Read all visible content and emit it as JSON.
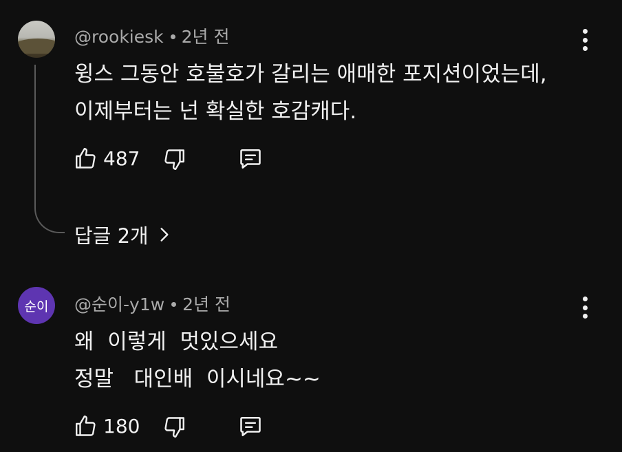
{
  "comments": [
    {
      "handle": "@rookiesk",
      "age": "2년 전",
      "text_lines": [
        "윙스 그동안 호불호가 갈리는 애매한 포지션이었는데,",
        "이제부터는 넌 확실한 호감캐다."
      ],
      "likes": "487",
      "avatar_icon": "landscape-photo-avatar"
    },
    {
      "handle": "@순이-y1w",
      "age": "2년 전",
      "avatar_letter": "순이",
      "text_lines": [
        "왜  이렇게  멋있으세요",
        "정말   대인배  이시네요~~"
      ],
      "likes": "180"
    }
  ],
  "replies": {
    "label": "답글 2개"
  },
  "icons": {
    "like": "thumbs-up-icon",
    "dislike": "thumbs-down-icon",
    "reply": "comment-icon",
    "more": "more-vertical-icon",
    "chevron": "chevron-right-icon"
  },
  "colors": {
    "background": "#0f0f0f",
    "text": "#f1f1f1",
    "meta": "#aaaaaa",
    "avatar_letter_bg": "#5e35b1"
  }
}
